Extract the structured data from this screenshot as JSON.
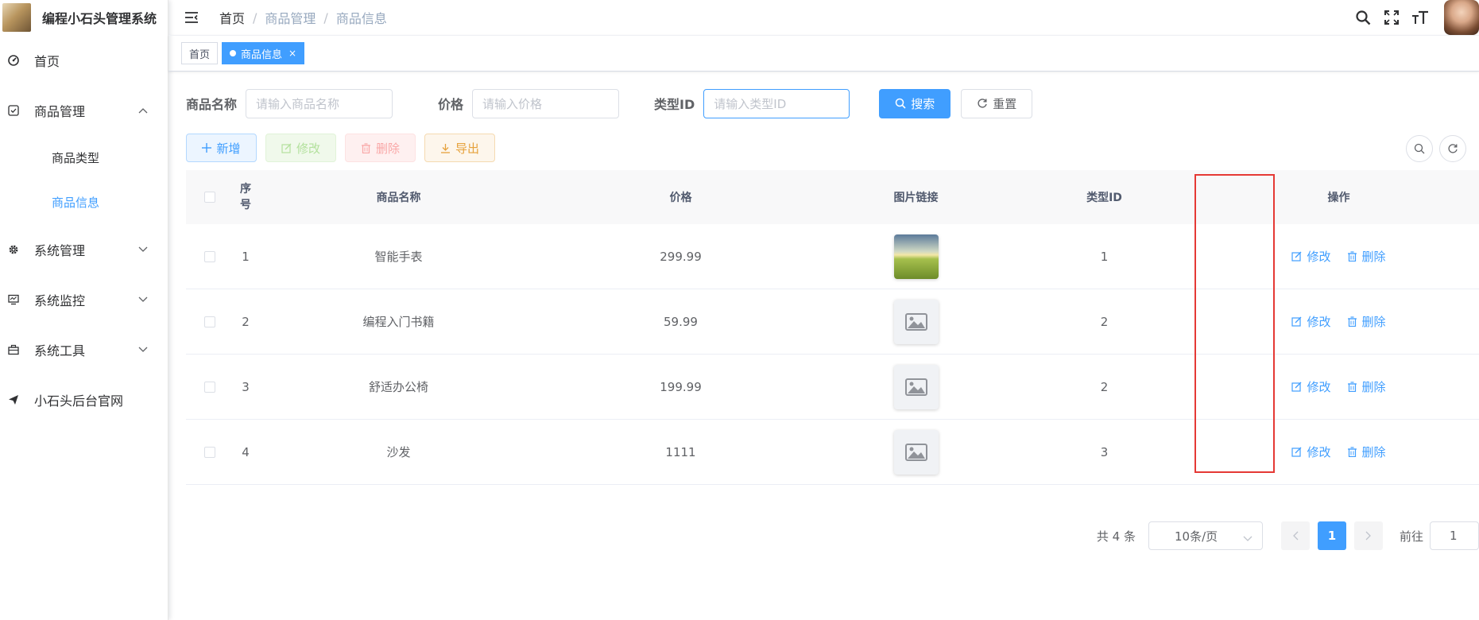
{
  "app": {
    "title": "编程小石头管理系统"
  },
  "sidebar": {
    "items": [
      {
        "label": "首页",
        "icon": "dashboard-icon"
      },
      {
        "label": "商品管理",
        "icon": "checkbox-icon",
        "expanded": true,
        "children": [
          {
            "label": "商品类型",
            "active": false
          },
          {
            "label": "商品信息",
            "active": true
          }
        ]
      },
      {
        "label": "系统管理",
        "icon": "gear-icon"
      },
      {
        "label": "系统监控",
        "icon": "monitor-icon"
      },
      {
        "label": "系统工具",
        "icon": "toolbox-icon"
      },
      {
        "label": "小石头后台官网",
        "icon": "send-icon"
      }
    ]
  },
  "breadcrumb": [
    "首页",
    "商品管理",
    "商品信息"
  ],
  "tags": [
    {
      "label": "首页",
      "active": false
    },
    {
      "label": "商品信息",
      "active": true
    }
  ],
  "search": {
    "name_label": "商品名称",
    "name_placeholder": "请输入商品名称",
    "price_label": "价格",
    "price_placeholder": "请输入价格",
    "type_label": "类型ID",
    "type_placeholder": "请输入类型ID",
    "search_btn": "搜索",
    "reset_btn": "重置"
  },
  "toolbar": {
    "add": "新增",
    "edit": "修改",
    "delete": "删除",
    "export": "导出"
  },
  "table": {
    "columns": [
      "序号",
      "商品名称",
      "价格",
      "图片链接",
      "类型ID",
      "操作"
    ],
    "rows": [
      {
        "index": "1",
        "name": "智能手表",
        "price": "299.99",
        "image": "photo",
        "type_id": "1"
      },
      {
        "index": "2",
        "name": "编程入门书籍",
        "price": "59.99",
        "image": "placeholder",
        "type_id": "2"
      },
      {
        "index": "3",
        "name": "舒适办公椅",
        "price": "199.99",
        "image": "placeholder",
        "type_id": "2"
      },
      {
        "index": "4",
        "name": "沙发",
        "price": "1111",
        "image": "placeholder",
        "type_id": "3"
      }
    ],
    "op_edit": "修改",
    "op_delete": "删除"
  },
  "pagination": {
    "total_text": "共 4 条",
    "page_size": "10条/页",
    "current_page": "1",
    "goto_label": "前往",
    "goto_value": "1"
  },
  "colors": {
    "primary": "#409eff",
    "highlight": "#e53935"
  }
}
